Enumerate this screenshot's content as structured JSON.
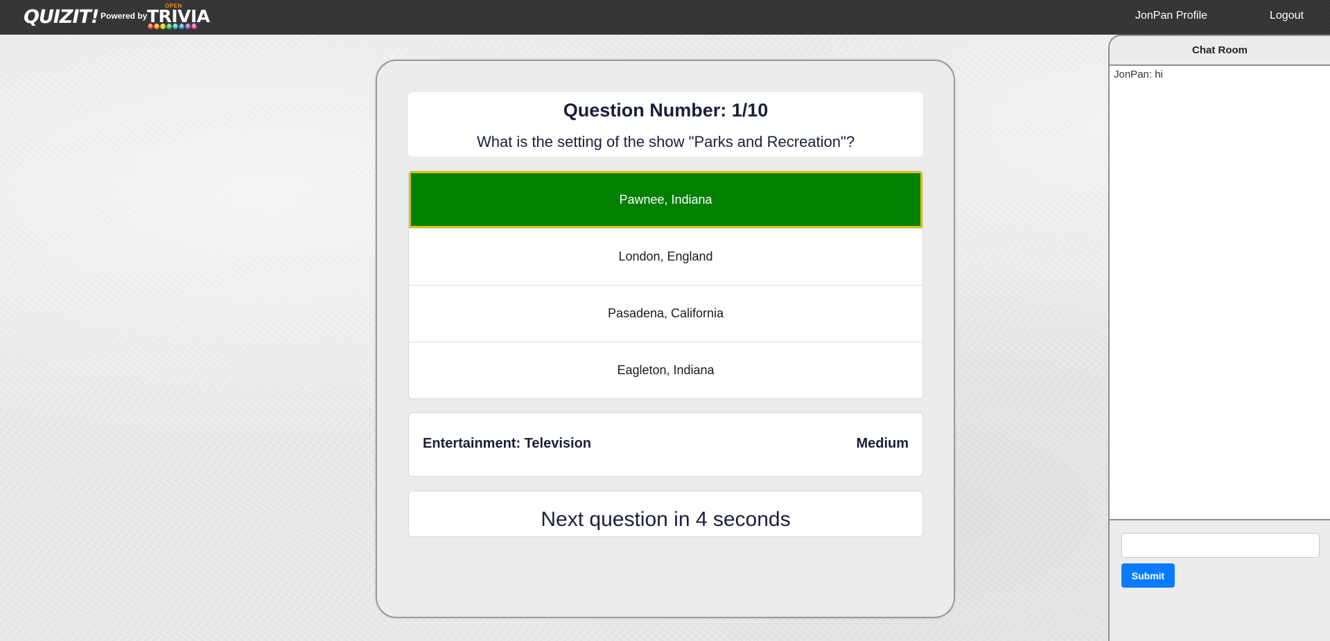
{
  "navbar": {
    "brand": "QUIZIT!",
    "powered_by": "Powered by",
    "partner_logo": {
      "top": "OPEN",
      "main": "TRIVIA",
      "bottom": [
        "D",
        "A",
        "T",
        "A",
        "B",
        "A",
        "S",
        "E"
      ],
      "bottom_colors": [
        "#e84c3d",
        "#f39c12",
        "#f1c40f",
        "#2ecc71",
        "#1abc9c",
        "#3498db",
        "#9b59b6",
        "#e84393"
      ]
    },
    "profile_link": "JonPan Profile",
    "logout_link": "Logout"
  },
  "quiz": {
    "question_number": "Question Number: 1/10",
    "question_text": "What is the setting of the show \"Parks and Recreation\"?",
    "answers": [
      {
        "label": "Pawnee, Indiana",
        "state": "correct"
      },
      {
        "label": "London, England",
        "state": "default"
      },
      {
        "label": "Pasadena, California",
        "state": "default"
      },
      {
        "label": "Eagleton, Indiana",
        "state": "default"
      }
    ],
    "category": "Entertainment: Television",
    "difficulty": "Medium",
    "timer_text": "Next question in 4 seconds"
  },
  "chat": {
    "title": "Chat Room",
    "messages": [
      {
        "text": "JonPan: hi"
      }
    ],
    "input_value": "",
    "input_placeholder": "",
    "submit_label": "Submit"
  },
  "colors": {
    "navbar_bg": "#353535",
    "correct_answer_bg": "#028002",
    "correct_answer_border": "#d6c21a",
    "submit_button": "#0a7bff",
    "text_dark": "#1b1e3a"
  }
}
